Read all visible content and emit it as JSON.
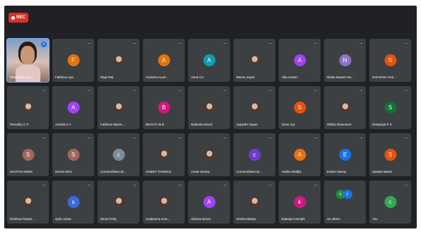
{
  "recording": {
    "label": "REC"
  },
  "participants": [
    {
      "name": "Shareena Vara...",
      "kind": "video",
      "speaking": true
    },
    {
      "name": "Fathima Liya",
      "letter": "F",
      "color": "#e8710a"
    },
    {
      "name": "Riga Reji",
      "kind": "photo"
    },
    {
      "name": "Arunima Arunl...",
      "letter": "A",
      "color": "#e8710a"
    },
    {
      "name": "Asna CA",
      "letter": "A",
      "color": "#129eaf"
    },
    {
      "name": "Meera Jayan",
      "kind": "photo"
    },
    {
      "name": "Alfa Azeem",
      "letter": "A",
      "color": "#a142f4"
    },
    {
      "name": "Nisba Nasser Na...",
      "letter": "N",
      "color": "#8e72c4"
    },
    {
      "name": "SAFVANA YAS...",
      "letter": "S",
      "color": "#e8520a"
    },
    {
      "name": "Parvathy C P",
      "kind": "photo"
    },
    {
      "name": "Aneeta K A",
      "letter": "A",
      "color": "#a142f4"
    },
    {
      "name": "Fathima Nasrin...",
      "kind": "photo"
    },
    {
      "name": "BHAVYA B B",
      "letter": "B",
      "color": "#d01884"
    },
    {
      "name": "Nafeesa Ismail",
      "kind": "photo"
    },
    {
      "name": "Jayanthi Jayan",
      "kind": "photo"
    },
    {
      "name": "Sona Joy",
      "letter": "S",
      "color": "#e8520a"
    },
    {
      "name": "Shifna Shameem",
      "kind": "photo"
    },
    {
      "name": "Sreepriya P S",
      "letter": "S",
      "color": "#137333"
    },
    {
      "name": "SAVITHA SREE",
      "letter": "S",
      "color": "#a0675a"
    },
    {
      "name": "SHIJO MOL",
      "letter": "S",
      "color": "#a0675a"
    },
    {
      "name": "commerfiast4 St...",
      "letter": "c",
      "color": "#7c8c98"
    },
    {
      "name": "JOMSY THOMAS",
      "kind": "photo"
    },
    {
      "name": "Annie Sreeta",
      "kind": "photo"
    },
    {
      "name": "commerfiast3 St...",
      "letter": "c",
      "color": "#6f3ccd"
    },
    {
      "name": "Anitha Shalby",
      "letter": "A",
      "color": "#e8710a"
    },
    {
      "name": "Esther Nanny",
      "letter": "E",
      "color": "#1a73e8"
    },
    {
      "name": "Sandra Martin",
      "letter": "S",
      "color": "#e8520a"
    },
    {
      "name": "Reshma Param...",
      "kind": "photo"
    },
    {
      "name": "sythu nissa",
      "letter": "s",
      "color": "#3c68d8"
    },
    {
      "name": "Nimmi Poly",
      "kind": "photo"
    },
    {
      "name": "Anakeena Anto...",
      "kind": "photo"
    },
    {
      "name": "Aleena Simon",
      "letter": "A",
      "color": "#a142f4"
    },
    {
      "name": "Sneha Mariya",
      "kind": "photo"
    },
    {
      "name": "kadeeja minnath",
      "letter": "k",
      "color": "#d01884"
    },
    {
      "name": "16 others",
      "kind": "others"
    },
    {
      "name": "You",
      "letter": "c",
      "color": "#34a853"
    }
  ],
  "others": {
    "letters": [
      "s",
      "c"
    ],
    "colors": [
      "#1e8e3e",
      "#1a73e8"
    ]
  },
  "icons": {
    "mic": "mic-off-icon",
    "speaking": "audio-wave-icon"
  }
}
